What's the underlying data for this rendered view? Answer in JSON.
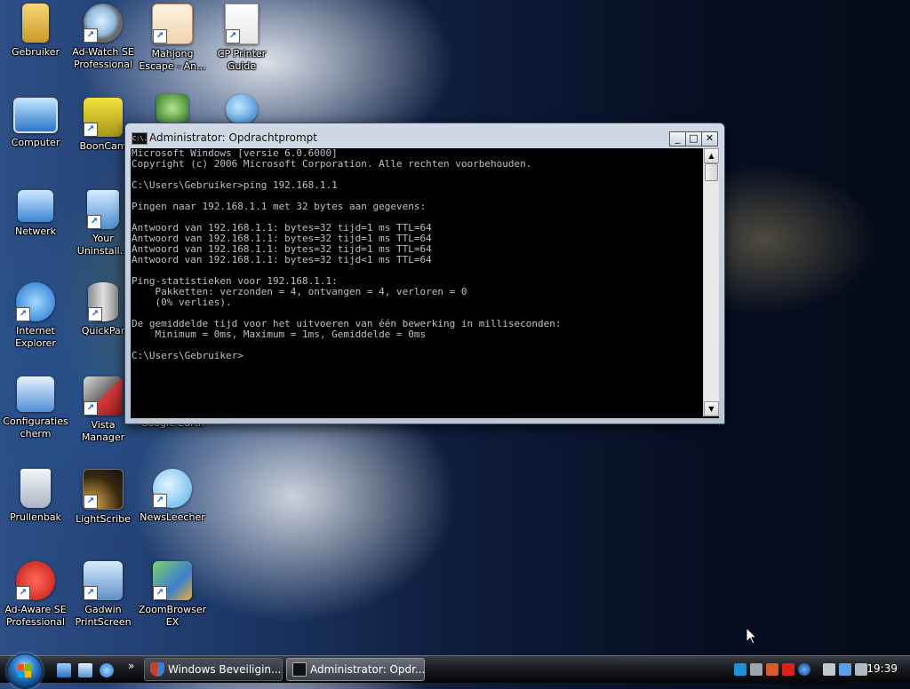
{
  "desktop": {
    "icons": [
      {
        "label": "Gebruiker"
      },
      {
        "label": "Ad-Watch SE\nProfessional"
      },
      {
        "label": "Mahjong\nEscape - An..."
      },
      {
        "label": "CP Printer\nGuide"
      },
      {
        "label": "Computer"
      },
      {
        "label": "BoonCam"
      },
      {
        "label": "Netwerk"
      },
      {
        "label": "Your\nUninstall..."
      },
      {
        "label": "Internet\nExplorer"
      },
      {
        "label": "QuickPar"
      },
      {
        "label": "Configuraties\ncherm"
      },
      {
        "label": "Vista\nManager"
      },
      {
        "label": "Google Earth"
      },
      {
        "label": "Prullenbak"
      },
      {
        "label": "LightScribe"
      },
      {
        "label": "NewsLeecher"
      },
      {
        "label": "Ad-Aware SE\nProfessional"
      },
      {
        "label": "Gadwin\nPrintScreen"
      },
      {
        "label": "ZoomBrowser\nEX"
      }
    ]
  },
  "console": {
    "title": "Administrator: Opdrachtprompt",
    "title_icon_text": "C:\\.",
    "minimize": "_",
    "maximize": "□",
    "close": "✕",
    "scroll_up": "▲",
    "scroll_down": "▼",
    "output": "Microsoft Windows [versie 6.0.6000]\nCopyright (c) 2006 Microsoft Corporation. Alle rechten voorbehouden.\n\nC:\\Users\\Gebruiker>ping 192.168.1.1\n\nPingen naar 192.168.1.1 met 32 bytes aan gegevens:\n\nAntwoord van 192.168.1.1: bytes=32 tijd=1 ms TTL=64\nAntwoord van 192.168.1.1: bytes=32 tijd=1 ms TTL=64\nAntwoord van 192.168.1.1: bytes=32 tijd=1 ms TTL=64\nAntwoord van 192.168.1.1: bytes=32 tijd<1 ms TTL=64\n\nPing-statistieken voor 192.168.1.1:\n    Pakketten: verzonden = 4, ontvangen = 4, verloren = 0\n    (0% verlies).\n\nDe gemiddelde tijd voor het uitvoeren van één bewerking in milliseconden:\n    Minimum = 0ms, Maximum = 1ms, Gemiddelde = 0ms\n\nC:\\Users\\Gebruiker>"
  },
  "taskbar": {
    "quicklaunch_more": "»",
    "buttons": [
      {
        "label": "Windows Beveiligin...",
        "icon": "shield-icon"
      },
      {
        "label": "Administrator: Opdr...",
        "icon": "console-icon"
      }
    ],
    "clock": "19:39"
  },
  "colors": {
    "console_bg": "#000000",
    "console_text": "#c0c0c0",
    "taskbar": "#1a1b1f"
  }
}
